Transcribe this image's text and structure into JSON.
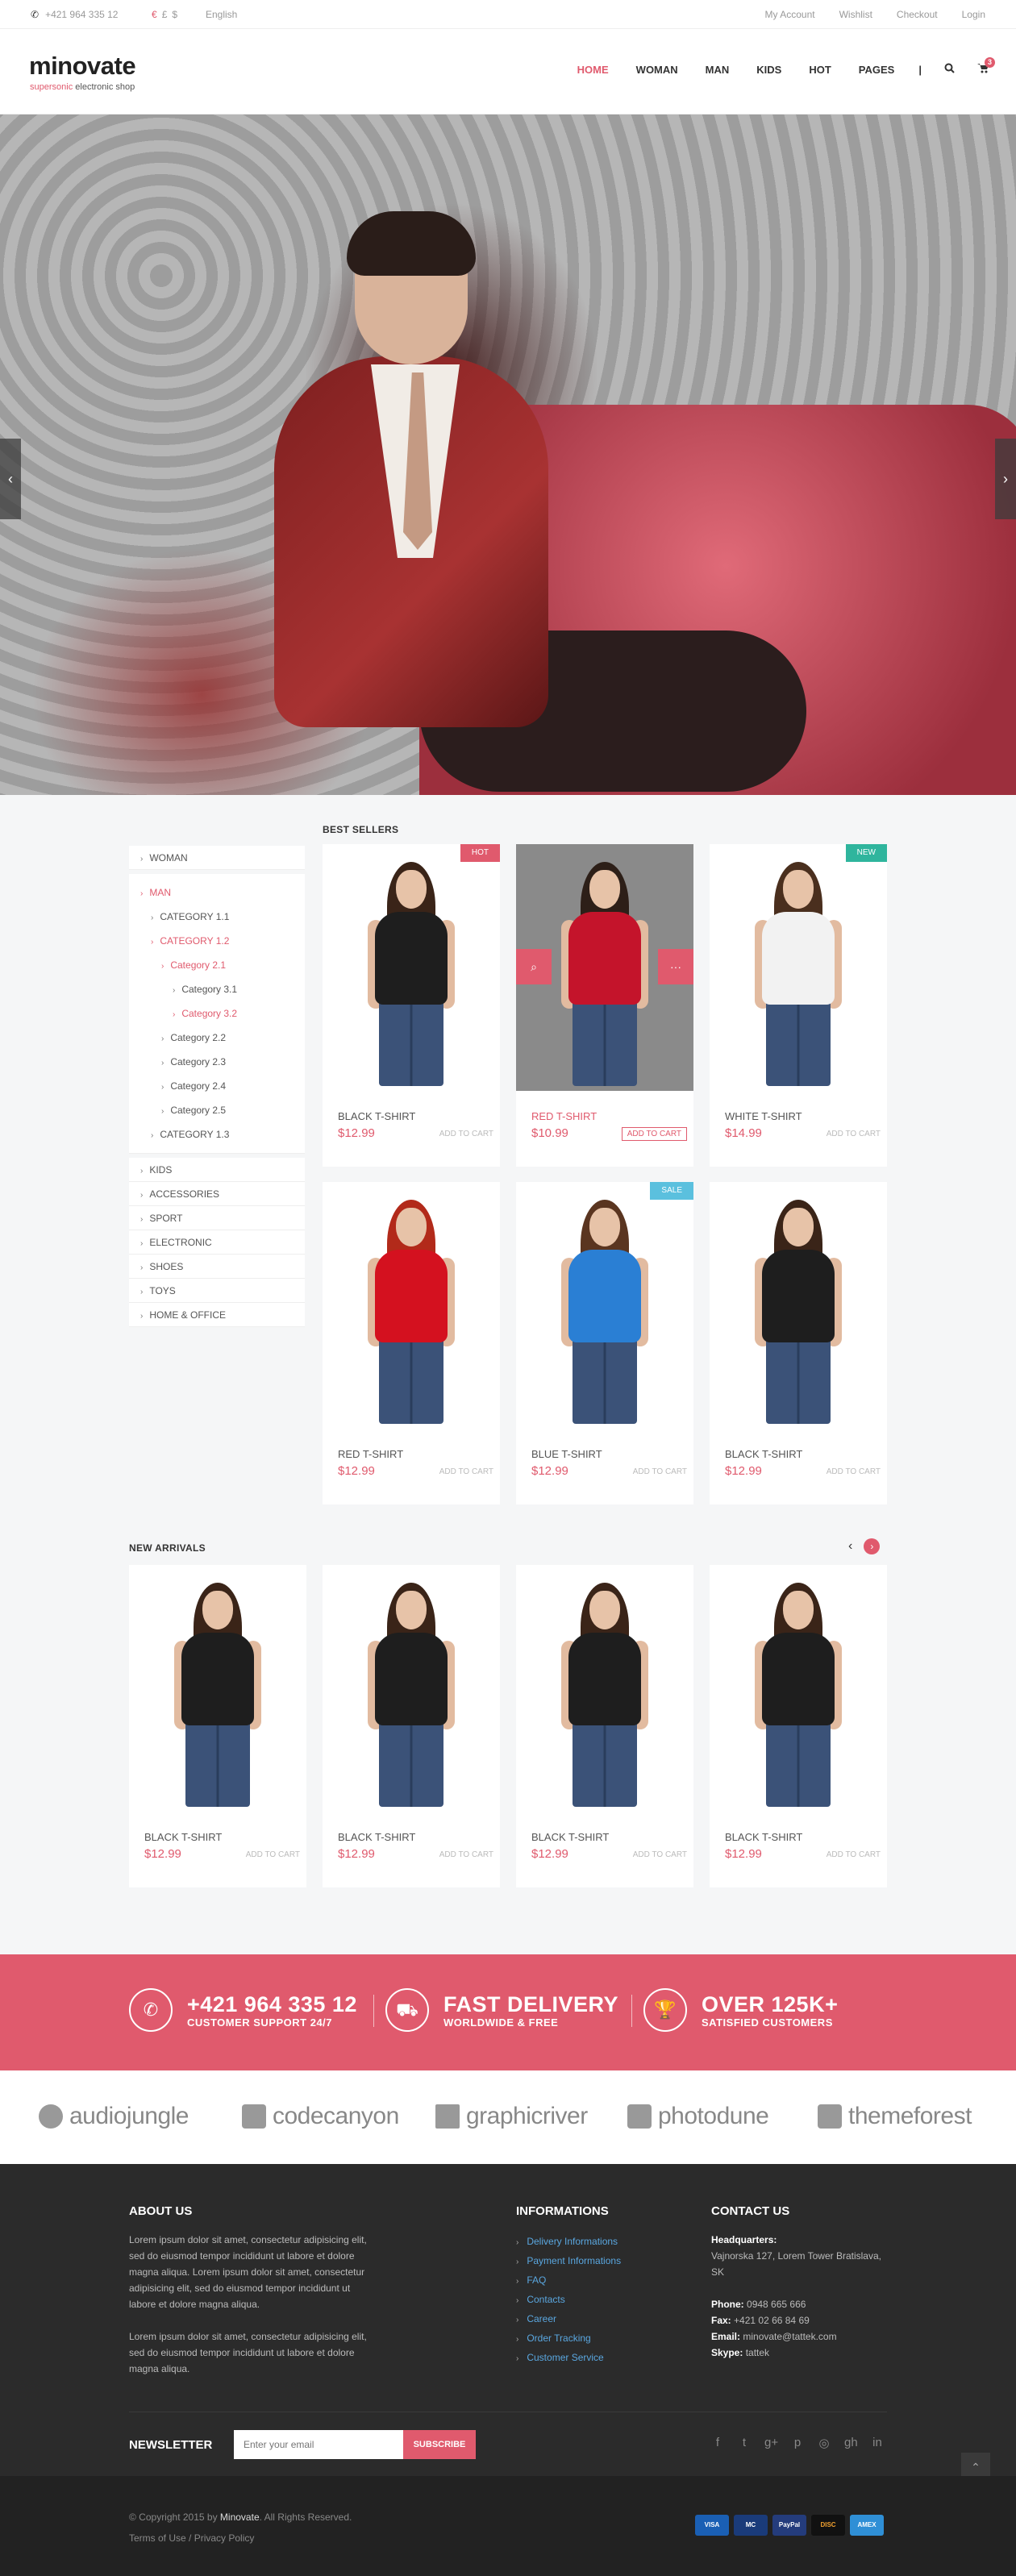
{
  "topbar": {
    "phone": "+421 964 335 12",
    "currencies": [
      "€",
      "£",
      "$"
    ],
    "language": "English",
    "links": [
      "My Account",
      "Wishlist",
      "Checkout",
      "Login"
    ]
  },
  "header": {
    "logo": "minovate",
    "tagline_accent": "supersonic",
    "tagline_rest": "electronic shop",
    "nav": [
      "HOME",
      "WOMAN",
      "MAN",
      "KIDS",
      "HOT",
      "PAGES"
    ],
    "cart_count": "3"
  },
  "sidebar": {
    "top": "WOMAN",
    "man": "MAN",
    "sub": [
      {
        "label": "CATEGORY 1.1",
        "level": 1
      },
      {
        "label": "CATEGORY 1.2",
        "level": 1,
        "active": true
      },
      {
        "label": "Category 2.1",
        "level": 2,
        "active": true
      },
      {
        "label": "Category 3.1",
        "level": 3
      },
      {
        "label": "Category 3.2",
        "level": 3,
        "active": true
      },
      {
        "label": "Category 2.2",
        "level": 2
      },
      {
        "label": "Category 2.3",
        "level": 2
      },
      {
        "label": "Category 2.4",
        "level": 2
      },
      {
        "label": "Category 2.5",
        "level": 2
      },
      {
        "label": "CATEGORY 1.3",
        "level": 1
      }
    ],
    "rest": [
      "KIDS",
      "ACCESSORIES",
      "SPORT",
      "ELECTRONIC",
      "SHOES",
      "TOYS",
      "HOME & OFFICE"
    ]
  },
  "best_sellers": {
    "title": "BEST SELLERS",
    "add_to_cart": "ADD TO CART",
    "products": [
      {
        "name": "BLACK T-SHIRT",
        "price": "$12.99",
        "badge": "HOT"
      },
      {
        "name": "RED T-SHIRT",
        "price": "$10.99",
        "badge": ""
      },
      {
        "name": "WHITE T-SHIRT",
        "price": "$14.99",
        "badge": "NEW"
      },
      {
        "name": "RED T-SHIRT",
        "price": "$12.99",
        "badge": ""
      },
      {
        "name": "BLUE T-SHIRT",
        "price": "$12.99",
        "badge": "SALE"
      },
      {
        "name": "BLACK T-SHIRT",
        "price": "$12.99",
        "badge": ""
      }
    ]
  },
  "new_arrivals": {
    "title": "NEW ARRIVALS",
    "products": [
      {
        "name": "BLACK T-SHIRT",
        "price": "$12.99"
      },
      {
        "name": "BLACK T-SHIRT",
        "price": "$12.99"
      },
      {
        "name": "BLACK T-SHIRT",
        "price": "$12.99"
      },
      {
        "name": "BLACK T-SHIRT",
        "price": "$12.99"
      }
    ]
  },
  "stats": [
    {
      "big": "+421 964 335 12",
      "small": "CUSTOMER SUPPORT 24/7",
      "icon": "phone-icon"
    },
    {
      "big": "FAST DELIVERY",
      "small": "WORLDWIDE & FREE",
      "icon": "truck-icon"
    },
    {
      "big": "OVER 125K+",
      "small": "SATISFIED CUSTOMERS",
      "icon": "trophy-icon"
    }
  ],
  "brands": [
    "audiojungle",
    "codecanyon",
    "graphicriver",
    "photodune",
    "themeforest"
  ],
  "footer": {
    "about_title": "ABOUT US",
    "about_p1": "Lorem ipsum dolor sit amet, consectetur adipisicing elit, sed do eiusmod tempor incididunt ut labore et dolore magna aliqua. Lorem ipsum dolor sit amet, consectetur adipisicing elit, sed do eiusmod tempor incididunt ut labore et dolore magna aliqua.",
    "about_p2": "Lorem ipsum dolor sit amet, consectetur adipisicing elit, sed do eiusmod tempor incididunt ut labore et dolore magna aliqua.",
    "info_title": "INFORMATIONS",
    "info_links": [
      "Delivery Informations",
      "Payment Informations",
      "FAQ",
      "Contacts",
      "Career",
      "Order Tracking",
      "Customer Service"
    ],
    "contact_title": "CONTACT US",
    "hq_label": "Headquarters:",
    "hq_address": "Vajnorska 127, Lorem Tower Bratislava, SK",
    "phone_label": "Phone:",
    "phone": "0948 665 666",
    "fax_label": "Fax:",
    "fax": "+421 02 66 84 69",
    "email_label": "Email:",
    "email": "minovate@tattek.com",
    "skype_label": "Skype:",
    "skype": "tattek",
    "newsletter_label": "NEWSLETTER",
    "newsletter_placeholder": "Enter your email",
    "subscribe": "SUBSCRIBE",
    "copyright_pre": "© Copyright 2015 by",
    "copyright_brand": "Minovate",
    "copyright_post": ". All Rights Reserved.",
    "terms": "Terms of Use",
    "privacy": "Privacy Policy",
    "payments": [
      "VISA",
      "MC",
      "PayPal",
      "DISC",
      "AMEX"
    ]
  }
}
